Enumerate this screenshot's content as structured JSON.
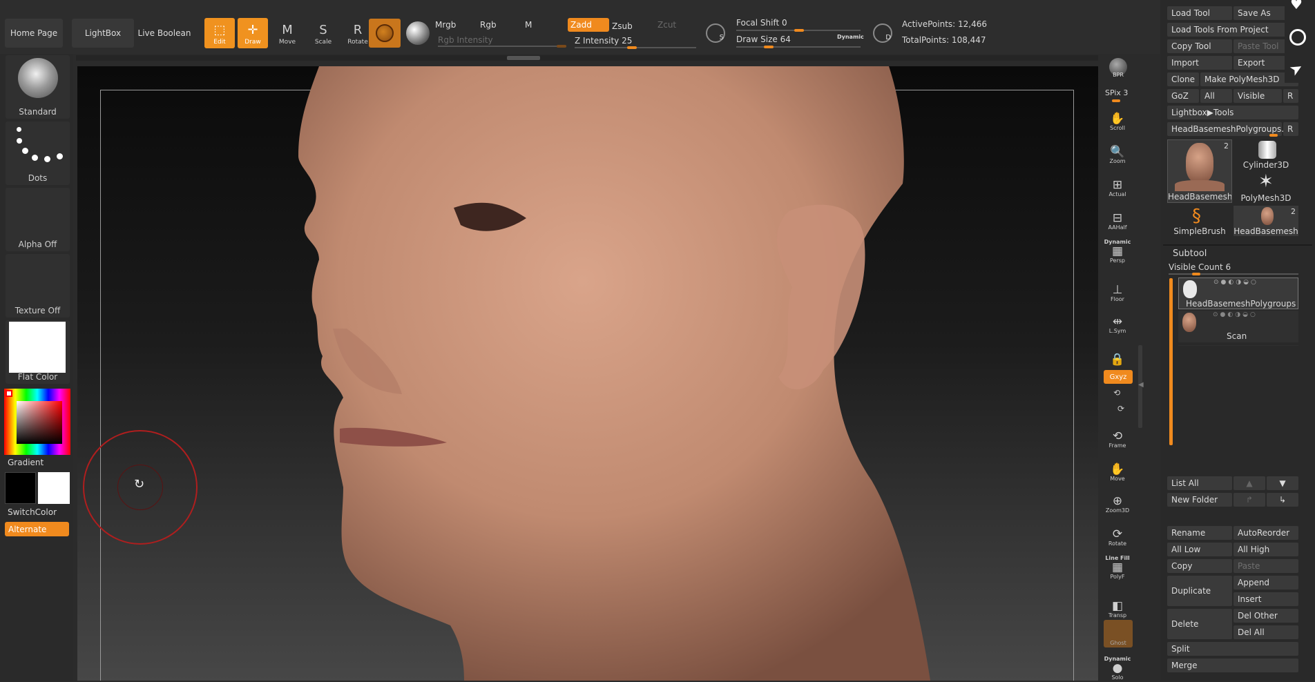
{
  "top": {
    "home": "Home Page",
    "lightbox": "LightBox",
    "live_boolean": "Live Boolean",
    "tools": [
      {
        "glyph": "⬚",
        "label": "Edit"
      },
      {
        "glyph": "✛",
        "label": "Draw"
      },
      {
        "glyph": "M",
        "label": "Move"
      },
      {
        "glyph": "S",
        "label": "Scale"
      },
      {
        "glyph": "R",
        "label": "Rotate"
      }
    ],
    "mrgb": "Mrgb",
    "rgb": "Rgb",
    "m": "M",
    "zadd": "Zadd",
    "zsub": "Zsub",
    "zcut": "Zcut",
    "rgb_intensity": "Rgb Intensity",
    "z_intensity": "Z Intensity 25",
    "focal_shift": "Focal Shift 0",
    "draw_size": "Draw Size 64",
    "dynamic": "Dynamic",
    "active_points": "ActivePoints: 12,466",
    "total_points": "TotalPoints: 108,447",
    "s_icon": "S",
    "d_icon": "D"
  },
  "left": {
    "brush": "Standard",
    "stroke": "Dots",
    "alpha": "Alpha Off",
    "texture": "Texture Off",
    "material": "Flat Color",
    "gradient": "Gradient",
    "switch_color": "SwitchColor",
    "alternate": "Alternate"
  },
  "shelf": {
    "bpr": "BPR",
    "spix": "SPix 3",
    "items": [
      {
        "glyph": "✋",
        "label": "Scroll"
      },
      {
        "glyph": "🔍",
        "label": "Zoom"
      },
      {
        "glyph": "⊞",
        "label": "Actual"
      },
      {
        "glyph": "⊟",
        "label": "AAHalf"
      },
      {
        "glyph": "▦",
        "label": "Persp",
        "top": "Dynamic"
      },
      {
        "glyph": "⊥",
        "label": "Floor"
      },
      {
        "glyph": "⇹",
        "label": "L.Sym"
      },
      {
        "glyph": "🔒",
        "label": ""
      },
      {
        "glyph": "⟲",
        "label": "Frame"
      },
      {
        "glyph": "✋",
        "label": "Move"
      },
      {
        "glyph": "⊕",
        "label": "Zoom3D"
      },
      {
        "glyph": "⟳",
        "label": "Rotate"
      },
      {
        "glyph": "▦",
        "label": "PolyF",
        "top": "Line Fill"
      },
      {
        "glyph": "◧",
        "label": "Transp"
      },
      {
        "glyph": "●",
        "label": "Solo",
        "top": "Dynamic"
      }
    ],
    "xyz": "Gxyz",
    "ghost": "Ghost"
  },
  "tool": {
    "load_tool": "Load Tool",
    "save_as": "Save As",
    "load_from_project": "Load Tools From Project",
    "copy_tool": "Copy Tool",
    "paste_tool": "Paste Tool",
    "import": "Import",
    "export": "Export",
    "clone": "Clone",
    "make_polymesh": "Make PolyMesh3D",
    "goz": "GoZ",
    "all": "All",
    "visible": "Visible",
    "r": "R",
    "lightbox_tools": "Lightbox▶Tools",
    "current_tool": "HeadBasemeshPolygroups.",
    "thumbs": [
      {
        "label": "HeadBasemesh",
        "count": "2"
      },
      {
        "label": "Cylinder3D",
        "count": ""
      },
      {
        "label": "PolyMesh3D",
        "count": ""
      },
      {
        "label": "SimpleBrush",
        "count": ""
      },
      {
        "label": "HeadBasemesh",
        "count": "2"
      }
    ]
  },
  "subtool": {
    "title": "Subtool",
    "visible_count": "Visible Count 6",
    "items": [
      {
        "name": "HeadBasemeshPolygroups"
      },
      {
        "name": "Scan"
      }
    ],
    "list_all": "List All",
    "new_folder": "New Folder",
    "rename": "Rename",
    "autoreorder": "AutoReorder",
    "all_low": "All Low",
    "all_high": "All High",
    "copy": "Copy",
    "paste": "Paste",
    "duplicate": "Duplicate",
    "append": "Append",
    "insert": "Insert",
    "delete": "Delete",
    "del_other": "Del Other",
    "del_all": "Del All",
    "split": "Split",
    "merge": "Merge"
  },
  "colors": {
    "accent": "#f08a1e",
    "brush_ring": "#b01e1e"
  }
}
